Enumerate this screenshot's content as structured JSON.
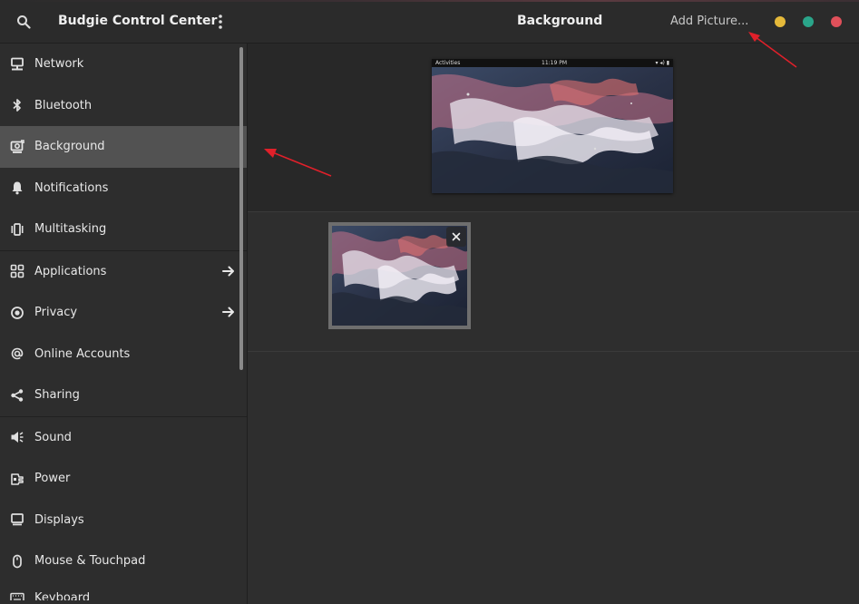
{
  "window": {
    "app_title": "Budgie Control Center",
    "panel_title": "Background",
    "add_picture_label": "Add Picture..."
  },
  "sidebar": {
    "items": [
      {
        "label": "Network",
        "icon": "network-icon"
      },
      {
        "label": "Bluetooth",
        "icon": "bluetooth-icon"
      },
      {
        "label": "Background",
        "icon": "background-icon",
        "active": true
      },
      {
        "label": "Notifications",
        "icon": "bell-icon"
      },
      {
        "label": "Multitasking",
        "icon": "multitasking-icon"
      },
      {
        "label": "Applications",
        "icon": "apps-grid-icon",
        "has_arrow": true
      },
      {
        "label": "Privacy",
        "icon": "privacy-icon",
        "has_arrow": true
      },
      {
        "label": "Online Accounts",
        "icon": "at-icon"
      },
      {
        "label": "Sharing",
        "icon": "share-icon"
      },
      {
        "label": "Sound",
        "icon": "speaker-icon"
      },
      {
        "label": "Power",
        "icon": "power-plug-icon"
      },
      {
        "label": "Displays",
        "icon": "display-icon"
      },
      {
        "label": "Mouse & Touchpad",
        "icon": "mouse-icon"
      },
      {
        "label": "Keyboard",
        "icon": "keyboard-icon"
      }
    ]
  },
  "preview": {
    "topbar_left": "Activities",
    "topbar_center": "11:19 PM"
  },
  "colors": {
    "accent_active": "#525252",
    "window_min": "#e5b93a",
    "window_max": "#2aa58a",
    "window_close": "#e0505a",
    "annotation_arrow": "#e0202a"
  }
}
